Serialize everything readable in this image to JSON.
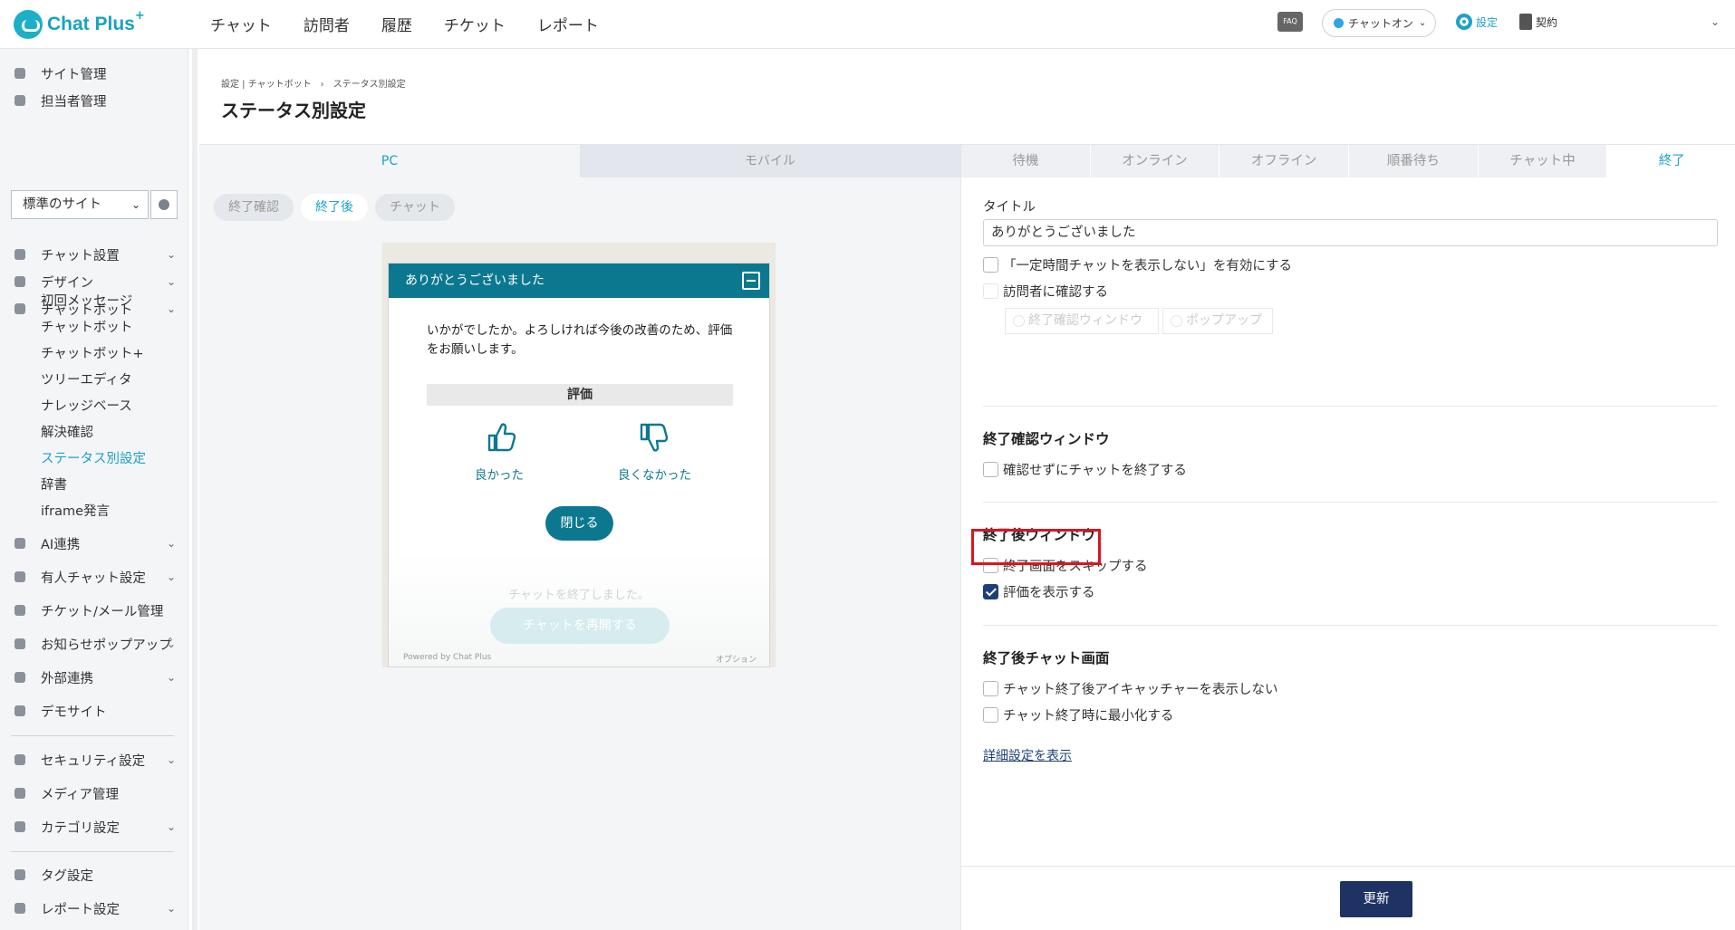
{
  "app": {
    "logo_text": "Chat Plus",
    "logo_sup": "+"
  },
  "topnav": [
    "チャット",
    "訪問者",
    "履歴",
    "チケット",
    "レポート"
  ],
  "header_right": {
    "faq": "FAQ",
    "status": "チャットオン",
    "settings": "設定",
    "contract": "契約"
  },
  "sidebar": {
    "top_items": [
      "サイト管理",
      "担当者管理"
    ],
    "site_select": "標準のサイト",
    "items": [
      {
        "label": "チャット設置",
        "chevron": true
      },
      {
        "label": "デザイン",
        "chevron": true
      },
      {
        "label": "チャットボット",
        "chevron": true
      }
    ],
    "sub_items": [
      "初回メッセージ",
      "チャットボット",
      "チャットボット+",
      "ツリーエディタ",
      "ナレッジベース",
      "解決確認",
      "ステータス別設定",
      "辞書",
      "iframe発言"
    ],
    "active_sub": "ステータス別設定",
    "items2": [
      {
        "label": "AI連携",
        "chevron": true
      },
      {
        "label": "有人チャット設定",
        "chevron": true
      },
      {
        "label": "チケット/メール管理",
        "chevron": false
      },
      {
        "label": "お知らせポップアップ",
        "chevron": true
      },
      {
        "label": "外部連携",
        "chevron": true
      },
      {
        "label": "デモサイト",
        "chevron": false
      }
    ],
    "items3": [
      {
        "label": "セキュリティ設定",
        "chevron": true
      },
      {
        "label": "メディア管理",
        "chevron": false
      },
      {
        "label": "カテゴリ設定",
        "chevron": true
      }
    ],
    "items4": [
      {
        "label": "タグ設定",
        "chevron": false
      },
      {
        "label": "レポート設定",
        "chevron": true
      }
    ]
  },
  "page": {
    "breadcrumb": "設定 | チャットボット　›　ステータス別設定",
    "title": "ステータス別設定"
  },
  "device_tabs": [
    "PC",
    "モバイル"
  ],
  "preview_tabs": [
    "終了確認",
    "終了後",
    "チャット"
  ],
  "chat_preview": {
    "header": "ありがとうございました",
    "message": "いかがでしたか。よろしければ今後の改善のため、評価をお願いします。",
    "rating_title": "評価",
    "good": "良かった",
    "bad": "良くなかった",
    "close": "閉じる",
    "ended": "チャットを終了しました。",
    "resume": "チャットを再開する",
    "powered": "Powered by Chat Plus",
    "option": "オプション"
  },
  "status_tabs": [
    "待機",
    "オンライン",
    "オフライン",
    "順番待ち",
    "チャット中",
    "終了"
  ],
  "active_status_tab": "終了",
  "form": {
    "title_label": "タイトル",
    "title_value": "ありがとうございました",
    "opt_hide": "「一定時間チャットを表示しない」を有効にする",
    "opt_confirm": "訪問者に確認する",
    "radio_window": "終了確認ウィンドウ",
    "radio_popup": "ポップアップ",
    "sec1_title": "終了確認ウィンドウ",
    "sec1_opt": "確認せずにチャットを終了する",
    "sec2_title": "終了後ウィンドウ",
    "sec2_opt1": "終了画面をスキップする",
    "sec2_opt2": "評価を表示する",
    "sec3_title": "終了後チャット画面",
    "sec3_opt1": "チャット終了後アイキャッチャーを表示しない",
    "sec3_opt2": "チャット終了時に最小化する",
    "detail_link": "詳細設定を表示",
    "update": "更新"
  },
  "colors": {
    "accent": "#1da2c3",
    "chat_header": "#0c7890",
    "primary_btn": "#1e3263",
    "highlight": "#d9161f"
  }
}
